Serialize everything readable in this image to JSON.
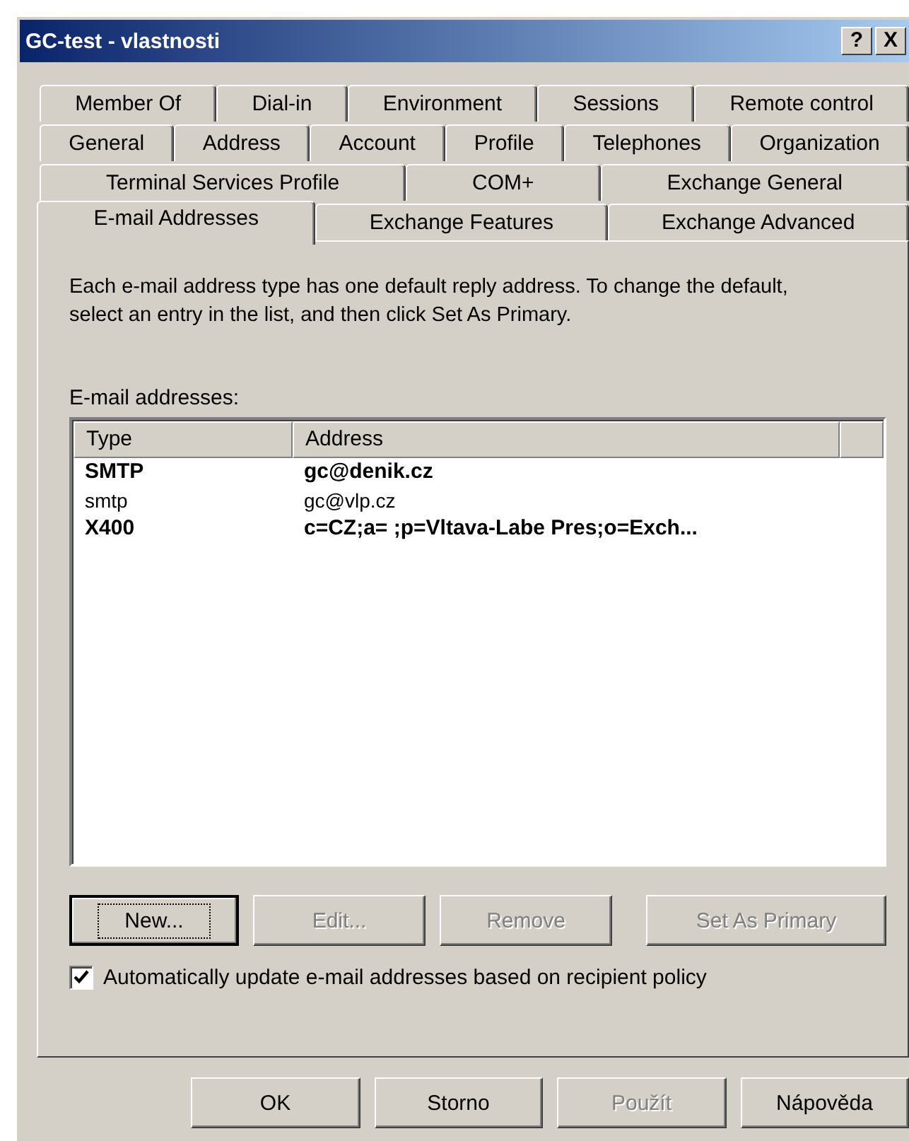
{
  "window": {
    "title": "GC-test - vlastnosti",
    "title_buttons": [
      "?",
      "X"
    ]
  },
  "tab_rows": [
    [
      {
        "label": "Member Of",
        "selected": false
      },
      {
        "label": "Dial-in",
        "selected": false
      },
      {
        "label": "Environment",
        "selected": false
      },
      {
        "label": "Sessions",
        "selected": false
      },
      {
        "label": "Remote control",
        "selected": false
      }
    ],
    [
      {
        "label": "General",
        "selected": false
      },
      {
        "label": "Address",
        "selected": false
      },
      {
        "label": "Account",
        "selected": false
      },
      {
        "label": "Profile",
        "selected": false
      },
      {
        "label": "Telephones",
        "selected": false
      },
      {
        "label": "Organization",
        "selected": false
      }
    ],
    [
      {
        "label": "Terminal Services Profile",
        "selected": false
      },
      {
        "label": "COM+",
        "selected": false
      },
      {
        "label": "Exchange General",
        "selected": false
      }
    ],
    [
      {
        "label": "E-mail Addresses",
        "selected": true
      },
      {
        "label": "Exchange Features",
        "selected": false
      },
      {
        "label": "Exchange Advanced",
        "selected": false
      }
    ]
  ],
  "description": "Each e-mail address type has one default reply address. To change the default, select an entry in the list, and then click Set As Primary.",
  "list_label": "E-mail addresses:",
  "table": {
    "columns": [
      "Type",
      "Address"
    ],
    "rows": [
      {
        "type": "SMTP",
        "address": "gc@denik.cz",
        "primary": true
      },
      {
        "type": "smtp",
        "address": "gc@vlp.cz",
        "primary": false
      },
      {
        "type": "X400",
        "address": "c=CZ;a= ;p=Vltava-Labe Pres;o=Exch...",
        "primary": true
      }
    ]
  },
  "list_buttons": [
    {
      "label": "New...",
      "disabled": false,
      "focused": true
    },
    {
      "label": "Edit...",
      "disabled": true,
      "focused": false
    },
    {
      "label": "Remove",
      "disabled": true,
      "focused": false
    },
    {
      "label": "Set As Primary",
      "disabled": true,
      "focused": false
    }
  ],
  "auto_update": {
    "label": "Automatically update e-mail addresses based on recipient policy",
    "checked": true
  },
  "dialog_buttons": [
    {
      "label": "OK",
      "disabled": false
    },
    {
      "label": "Storno",
      "disabled": false
    },
    {
      "label": "Použít",
      "disabled": true
    },
    {
      "label": "Nápověda",
      "disabled": false
    }
  ]
}
